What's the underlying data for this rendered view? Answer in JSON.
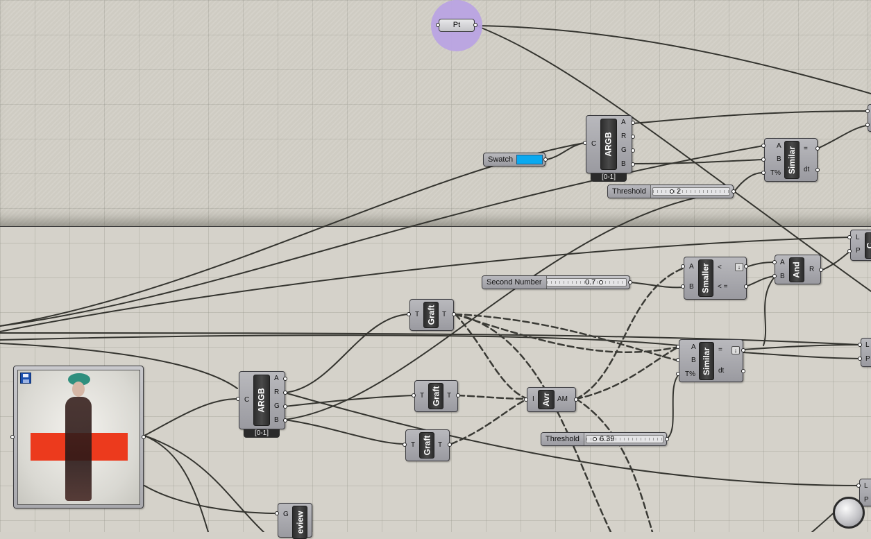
{
  "point_param": {
    "label": "Pt"
  },
  "swatch": {
    "label": "Swatch",
    "color": "#0aa9f0"
  },
  "argb_top": {
    "title": "ARGB",
    "input": "C",
    "outputs": [
      "A",
      "R",
      "G",
      "B"
    ],
    "range": "[0-1]"
  },
  "argb_bottom": {
    "title": "ARGB",
    "input": "C",
    "outputs": [
      "A",
      "R",
      "G",
      "B"
    ],
    "range": "[0-1]"
  },
  "threshold_top": {
    "label": "Threshold",
    "value": "2"
  },
  "threshold_bottom": {
    "label": "Threshold",
    "value": "6.39"
  },
  "second_number": {
    "label": "Second Number",
    "value": "0.7"
  },
  "similar_top": {
    "title": "Similar",
    "inputs": [
      "A",
      "B",
      "T%"
    ],
    "outputs": [
      "=",
      "dt"
    ]
  },
  "similar_bottom": {
    "title": "Similar",
    "inputs": [
      "A",
      "B",
      "T%"
    ],
    "outputs": [
      "=",
      "dt"
    ]
  },
  "smaller": {
    "title": "Smaller",
    "inputs": [
      "A",
      "B"
    ],
    "outputs": [
      "<",
      "< ="
    ]
  },
  "and_gate": {
    "title": "And",
    "inputs": [
      "A",
      "B"
    ],
    "output": "R"
  },
  "graft_1": {
    "title": "Graft",
    "input": "T",
    "output": "T"
  },
  "graft_2": {
    "title": "Graft",
    "input": "T",
    "output": "T"
  },
  "graft_3": {
    "title": "Graft",
    "input": "T",
    "output": "T"
  },
  "average": {
    "title": "Avr",
    "input": "I",
    "output": "AM"
  },
  "preview": {
    "title": "eview",
    "input": "G"
  },
  "edge_right": {
    "labels": [
      "L",
      "P",
      "L",
      "P",
      "L",
      "P"
    ],
    "cut_title": "C"
  },
  "accent": {
    "point_bubble": "#b9a3e3",
    "wire": "#3a3a36"
  }
}
